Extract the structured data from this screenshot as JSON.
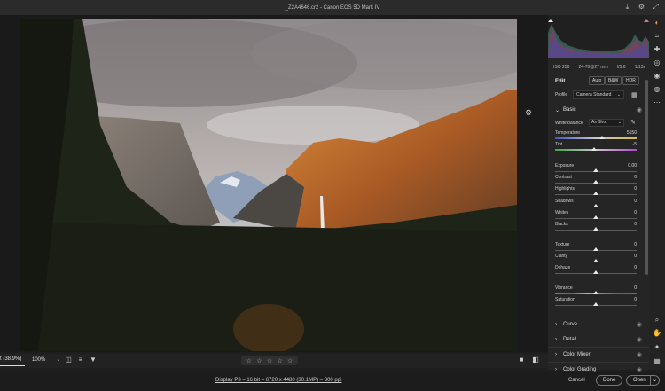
{
  "window": {
    "title": "_Z2A4646.cr2  -  Canon EOS 5D Mark IV"
  },
  "histogram": {
    "exif": [
      "ISO 250",
      "24-70@27 mm",
      "f/5.6",
      "1/13s"
    ]
  },
  "edit": {
    "title": "Edit",
    "auto_label": "Auto",
    "bw_label": "B&W",
    "hdr_label": "HDR",
    "profile_label": "Profile",
    "profile_value": "Camera Standard"
  },
  "basic": {
    "header": "Basic",
    "wb_label": "White balance",
    "wb_value": "As Shot",
    "sliders": [
      {
        "label": "Temperature",
        "value": "5150",
        "pos": 0.58
      },
      {
        "label": "Tint",
        "value": "-5",
        "pos": 0.48
      },
      {
        "label": "Exposure",
        "value": "0.00",
        "pos": 0.5
      },
      {
        "label": "Contrast",
        "value": "0",
        "pos": 0.5
      },
      {
        "label": "Highlights",
        "value": "0",
        "pos": 0.5
      },
      {
        "label": "Shadows",
        "value": "0",
        "pos": 0.5
      },
      {
        "label": "Whites",
        "value": "0",
        "pos": 0.5
      },
      {
        "label": "Blacks",
        "value": "0",
        "pos": 0.5
      },
      {
        "label": "Texture",
        "value": "0",
        "pos": 0.5
      },
      {
        "label": "Clarity",
        "value": "0",
        "pos": 0.5
      },
      {
        "label": "Dehaze",
        "value": "0",
        "pos": 0.5
      },
      {
        "label": "Vibrance",
        "value": "0",
        "pos": 0.5
      },
      {
        "label": "Saturation",
        "value": "0",
        "pos": 0.5
      }
    ]
  },
  "sections": [
    "Curve",
    "Detail",
    "Color Mixer",
    "Color Grading"
  ],
  "bottombar": {
    "zoom_fit": "t (38.9%)",
    "zoom_value": "100%",
    "stars": [
      "☆",
      "☆",
      "☆",
      "☆",
      "☆"
    ]
  },
  "footer": {
    "workflow_info": "Display P3 – 16 bit – 6720 x 4480 (30.1MP) – 300 ppi",
    "cancel_label": "Cancel",
    "done_label": "Done",
    "open_label": "Open"
  },
  "icons": {
    "accent": "#e8a040",
    "toolbar": [
      "edit-icon",
      "crop-icon",
      "heal-icon",
      "mask-icon",
      "redeye-icon",
      "presets-icon",
      "more-icon",
      "zoom-icon",
      "hand-icon",
      "sampler-icon",
      "grid-icon"
    ]
  }
}
